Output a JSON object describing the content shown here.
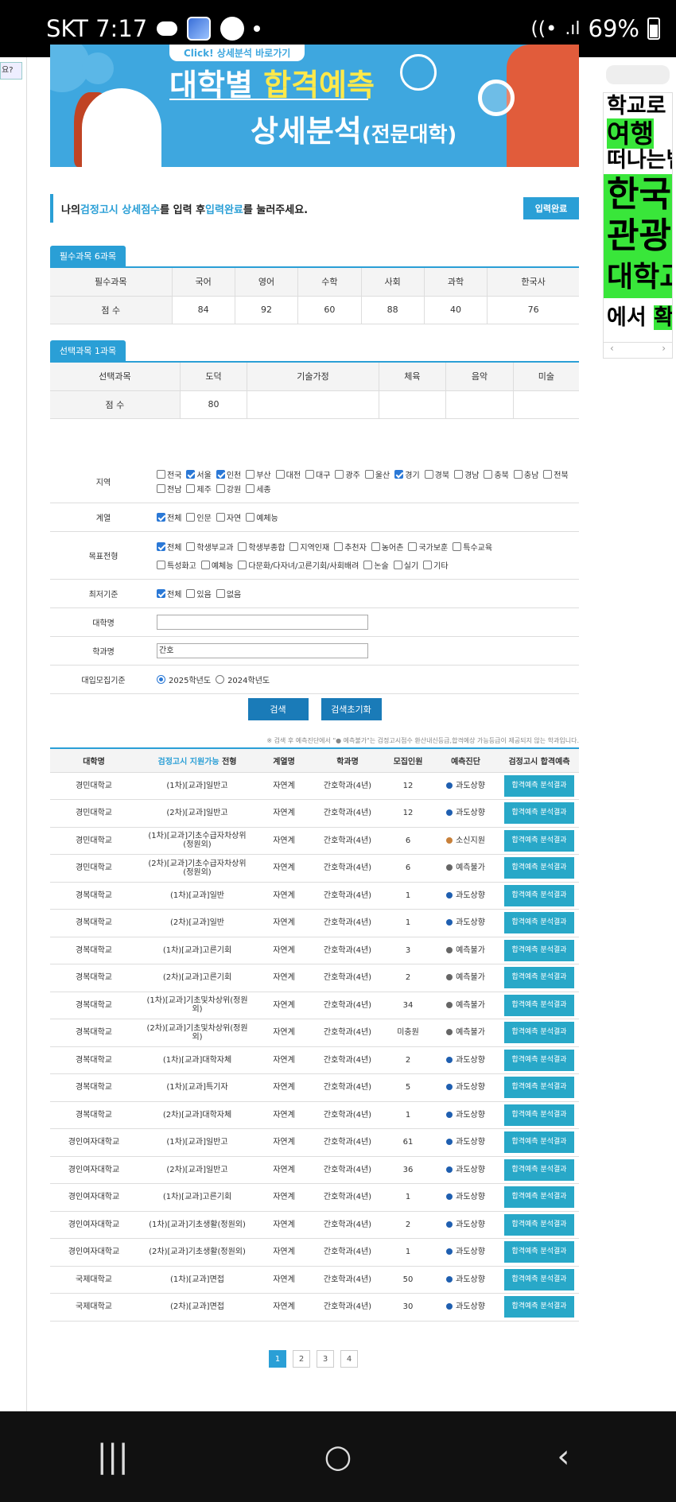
{
  "status": {
    "carrier_time": "SKT 7:17",
    "battery": "69%"
  },
  "left_stub": {
    "text": "요?"
  },
  "banner": {
    "tag": "Click! 상세분석 바로가기",
    "title_white": "대학별 ",
    "title_yellow": "합격예측",
    "subtitle": "상세분석",
    "subtitle_small": "(전문대학)"
  },
  "instruction": {
    "p1": "나의 ",
    "p2": "검정고시 상세점수",
    "p3": "를 입력 후 ",
    "p4": "입력완료",
    "p5": "를 눌러주세요.",
    "button": "입력완료"
  },
  "required": {
    "tab": "필수과목 6과목",
    "headers": [
      "필수과목",
      "국어",
      "영어",
      "수학",
      "사회",
      "과학",
      "한국사"
    ],
    "scores": [
      "점 수",
      "84",
      "92",
      "60",
      "88",
      "40",
      "76"
    ]
  },
  "elective": {
    "tab": "선택과목 1과목",
    "headers": [
      "선택과목",
      "도덕",
      "기술가정",
      "체육",
      "음악",
      "미술"
    ],
    "scores": [
      "점 수",
      "80",
      "",
      "",
      "",
      ""
    ]
  },
  "filters": {
    "region": {
      "label": "지역",
      "options": [
        {
          "t": "전국",
          "on": false
        },
        {
          "t": "서울",
          "on": true
        },
        {
          "t": "인천",
          "on": true
        },
        {
          "t": "부산",
          "on": false
        },
        {
          "t": "대전",
          "on": false
        },
        {
          "t": "대구",
          "on": false
        },
        {
          "t": "광주",
          "on": false
        },
        {
          "t": "울산",
          "on": false
        },
        {
          "t": "경기",
          "on": true
        },
        {
          "t": "경북",
          "on": false
        },
        {
          "t": "경남",
          "on": false
        },
        {
          "t": "충북",
          "on": false
        },
        {
          "t": "충남",
          "on": false
        },
        {
          "t": "전북",
          "on": false
        },
        {
          "t": "전남",
          "on": false
        },
        {
          "t": "제주",
          "on": false
        },
        {
          "t": "강원",
          "on": false
        },
        {
          "t": "세종",
          "on": false
        }
      ]
    },
    "track": {
      "label": "계열",
      "options": [
        {
          "t": "전체",
          "on": true
        },
        {
          "t": "인문",
          "on": false
        },
        {
          "t": "자연",
          "on": false
        },
        {
          "t": "예체능",
          "on": false
        }
      ]
    },
    "type": {
      "label": "목표전형",
      "options": [
        {
          "t": "전체",
          "on": true
        },
        {
          "t": "학생부교과",
          "on": false
        },
        {
          "t": "학생부종합",
          "on": false
        },
        {
          "t": "지역인재",
          "on": false
        },
        {
          "t": "추천자",
          "on": false
        },
        {
          "t": "농어촌",
          "on": false
        },
        {
          "t": "국가보훈",
          "on": false
        },
        {
          "t": "특수교육",
          "on": false
        },
        {
          "t": "특성화고",
          "on": false
        },
        {
          "t": "예체능",
          "on": false
        },
        {
          "t": "다문화/다자녀/고른기회/사회배려",
          "on": false
        },
        {
          "t": "논술",
          "on": false
        },
        {
          "t": "실기",
          "on": false
        },
        {
          "t": "기타",
          "on": false
        }
      ]
    },
    "min": {
      "label": "최저기준",
      "options": [
        {
          "t": "전체",
          "on": true
        },
        {
          "t": "있음",
          "on": false
        },
        {
          "t": "없음",
          "on": false
        }
      ]
    },
    "univ": {
      "label": "대학명",
      "value": ""
    },
    "major": {
      "label": "학과명",
      "value": "간호"
    },
    "year": {
      "label": "대입모집기준",
      "options": [
        {
          "t": "2025학년도",
          "on": true
        },
        {
          "t": "2024학년도",
          "on": false
        }
      ]
    }
  },
  "buttons": {
    "search": "검색",
    "reset": "검색초기화"
  },
  "note": "※ 검색 후 예측진단에서 \"● 예측불가\"는 검정고시점수 환산내신등급,합격예상 가능등급이 제공되지 않는 학과입니다.",
  "results": {
    "headers": {
      "univ": "대학명",
      "type_pre": "검정고시 지원가능",
      "type_post": " 전형",
      "track": "계열명",
      "major": "학과명",
      "quota": "모집인원",
      "pred": "예측진단",
      "btn": "검정고시 합격예측"
    },
    "colors": {
      "blue": "#1f5fb0",
      "orange": "#c8803a",
      "gray": "#666666"
    },
    "rows": [
      {
        "u": "경민대학교",
        "t": "(1차)[교과]일반고",
        "g": "자연계",
        "m": "간호학과(4년)",
        "n": "12",
        "p": "과도상향",
        "c": "blue",
        "b": "합격예측 분석결과"
      },
      {
        "u": "경민대학교",
        "t": "(2차)[교과]일반고",
        "g": "자연계",
        "m": "간호학과(4년)",
        "n": "12",
        "p": "과도상향",
        "c": "blue",
        "b": "합격예측 분석결과"
      },
      {
        "u": "경민대학교",
        "t": "(1차)[교과]기초수급자차상위(정원외)",
        "g": "자연계",
        "m": "간호학과(4년)",
        "n": "6",
        "p": "소신지원",
        "c": "orange",
        "b": "합격예측 분석결과"
      },
      {
        "u": "경민대학교",
        "t": "(2차)[교과]기초수급자차상위(정원외)",
        "g": "자연계",
        "m": "간호학과(4년)",
        "n": "6",
        "p": "예측불가",
        "c": "gray",
        "b": "합격예측 분석결과"
      },
      {
        "u": "경복대학교",
        "t": "(1차)[교과]일반",
        "g": "자연계",
        "m": "간호학과(4년)",
        "n": "1",
        "p": "과도상향",
        "c": "blue",
        "b": "합격예측 분석결과"
      },
      {
        "u": "경복대학교",
        "t": "(2차)[교과]일반",
        "g": "자연계",
        "m": "간호학과(4년)",
        "n": "1",
        "p": "과도상향",
        "c": "blue",
        "b": "합격예측 분석결과"
      },
      {
        "u": "경복대학교",
        "t": "(1차)[교과]고른기회",
        "g": "자연계",
        "m": "간호학과(4년)",
        "n": "3",
        "p": "예측불가",
        "c": "gray",
        "b": "합격예측 분석결과"
      },
      {
        "u": "경복대학교",
        "t": "(2차)[교과]고른기회",
        "g": "자연계",
        "m": "간호학과(4년)",
        "n": "2",
        "p": "예측불가",
        "c": "gray",
        "b": "합격예측 분석결과"
      },
      {
        "u": "경복대학교",
        "t": "(1차)[교과]기초및차상위(정원외)",
        "g": "자연계",
        "m": "간호학과(4년)",
        "n": "34",
        "p": "예측불가",
        "c": "gray",
        "b": "합격예측 분석결과"
      },
      {
        "u": "경복대학교",
        "t": "(2차)[교과]기초및차상위(정원외)",
        "g": "자연계",
        "m": "간호학과(4년)",
        "n": "미충원",
        "p": "예측불가",
        "c": "gray",
        "b": "합격예측 분석결과"
      },
      {
        "u": "경복대학교",
        "t": "(1차)[교과]대학자체",
        "g": "자연계",
        "m": "간호학과(4년)",
        "n": "2",
        "p": "과도상향",
        "c": "blue",
        "b": "합격예측 분석결과"
      },
      {
        "u": "경복대학교",
        "t": "(1차)[교과]특기자",
        "g": "자연계",
        "m": "간호학과(4년)",
        "n": "5",
        "p": "과도상향",
        "c": "blue",
        "b": "합격예측 분석결과"
      },
      {
        "u": "경복대학교",
        "t": "(2차)[교과]대학자체",
        "g": "자연계",
        "m": "간호학과(4년)",
        "n": "1",
        "p": "과도상향",
        "c": "blue",
        "b": "합격예측 분석결과"
      },
      {
        "u": "경인여자대학교",
        "t": "(1차)[교과]일반고",
        "g": "자연계",
        "m": "간호학과(4년)",
        "n": "61",
        "p": "과도상향",
        "c": "blue",
        "b": "합격예측 분석결과"
      },
      {
        "u": "경인여자대학교",
        "t": "(2차)[교과]일반고",
        "g": "자연계",
        "m": "간호학과(4년)",
        "n": "36",
        "p": "과도상향",
        "c": "blue",
        "b": "합격예측 분석결과"
      },
      {
        "u": "경인여자대학교",
        "t": "(1차)[교과]고른기회",
        "g": "자연계",
        "m": "간호학과(4년)",
        "n": "1",
        "p": "과도상향",
        "c": "blue",
        "b": "합격예측 분석결과"
      },
      {
        "u": "경인여자대학교",
        "t": "(1차)[교과]기초생활(정원외)",
        "g": "자연계",
        "m": "간호학과(4년)",
        "n": "2",
        "p": "과도상향",
        "c": "blue",
        "b": "합격예측 분석결과"
      },
      {
        "u": "경인여자대학교",
        "t": "(2차)[교과]기초생활(정원외)",
        "g": "자연계",
        "m": "간호학과(4년)",
        "n": "1",
        "p": "과도상향",
        "c": "blue",
        "b": "합격예측 분석결과"
      },
      {
        "u": "국제대학교",
        "t": "(1차)[교과]면접",
        "g": "자연계",
        "m": "간호학과(4년)",
        "n": "50",
        "p": "과도상향",
        "c": "blue",
        "b": "합격예측 분석결과"
      },
      {
        "u": "국제대학교",
        "t": "(2차)[교과]면접",
        "g": "자연계",
        "m": "간호학과(4년)",
        "n": "30",
        "p": "과도상향",
        "c": "blue",
        "b": "합격예측 분석결과"
      }
    ]
  },
  "pagination": [
    "1",
    "2",
    "3",
    "4"
  ],
  "ad": {
    "l1": "학교로",
    "l2": "여행",
    "l3": "떠나는법",
    "l4": "한국",
    "l5": "관광",
    "l6": "대학교",
    "l7a": "에서 ",
    "l7b": "확인"
  },
  "nav": {
    "recent": "|||",
    "home": "○",
    "back": "‹"
  }
}
